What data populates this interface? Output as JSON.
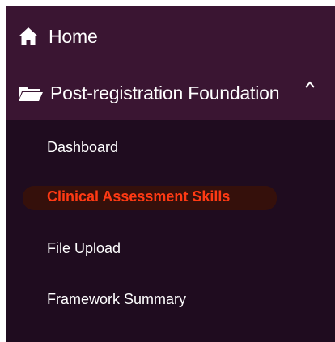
{
  "nav": {
    "home": {
      "label": "Home",
      "icon": "home-icon"
    },
    "section": {
      "label": "Post-registration Foundation",
      "icon": "folder-open-icon",
      "toggle_icon": "chevron-up-icon",
      "expanded": true
    },
    "subitems": [
      {
        "label": "Dashboard"
      },
      {
        "label": "Clinical Assessment Skills",
        "active": true
      },
      {
        "label": "File Upload"
      },
      {
        "label": "Framework Summary"
      }
    ]
  },
  "colors": {
    "top_background": "#3a1532",
    "sub_background": "#1f0c1f",
    "active_text": "#ff3a14",
    "text": "#ffffff"
  }
}
